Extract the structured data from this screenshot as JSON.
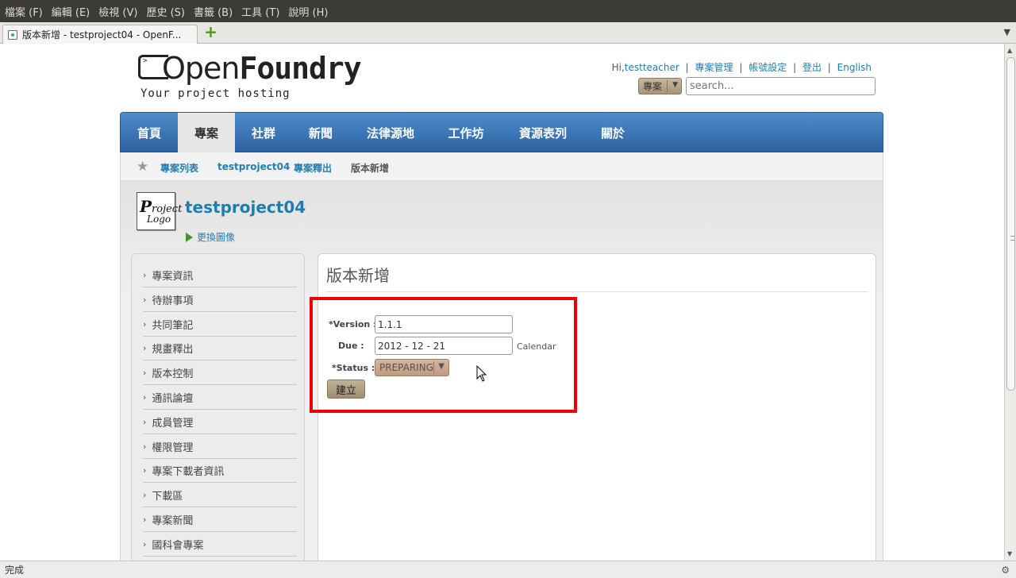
{
  "browser": {
    "menu": [
      "檔案 (F)",
      "編輯 (E)",
      "檢視 (V)",
      "歷史 (S)",
      "書籤 (B)",
      "工具 (T)",
      "說明 (H)"
    ],
    "tab_title": "版本新增 - testproject04 - OpenF...",
    "status": "完成",
    "new_tab_icon": "plus-icon"
  },
  "header": {
    "logo_open": "Open",
    "logo_foundry": "Foundry",
    "logo_caret": ">",
    "tagline": "Your project hosting",
    "hi_prefix": "Hi,",
    "user": "testteacher",
    "links": [
      "專案管理",
      "帳號設定",
      "登出",
      "English"
    ],
    "search_scope": "專案",
    "search_placeholder": "search..."
  },
  "nav": {
    "items": [
      "首頁",
      "專案",
      "社群",
      "新聞",
      "法律源地",
      "工作坊",
      "資源表列",
      "關於"
    ],
    "active_index": 1
  },
  "breadcrumb": {
    "items": [
      "專案列表",
      "testproject04",
      "專案釋出"
    ],
    "current": "版本新增"
  },
  "project": {
    "logo_line1_cap": "P",
    "logo_line1": "roject",
    "logo_line2": "Logo",
    "name": "testproject04",
    "change_image": "更換圖像"
  },
  "sidebar": {
    "items": [
      "專案資訊",
      "待辦事項",
      "共同筆記",
      "規畫釋出",
      "版本控制",
      "通訊論壇",
      "成員管理",
      "權限管理",
      "專案下載者資訊",
      "下載區",
      "專案新聞",
      "國科會專案"
    ]
  },
  "form": {
    "title": "版本新增",
    "version_label": "*Version :",
    "version_value": "1.1.1",
    "due_label": "Due :",
    "due_value": "2012 - 12 - 21",
    "calendar": "Calendar",
    "status_label": "*Status :",
    "status_value": "PREPARING",
    "submit": "建立"
  },
  "colors": {
    "nav": "#2c63a3",
    "link": "#1f7fb0",
    "highlight": "#e8000b"
  }
}
